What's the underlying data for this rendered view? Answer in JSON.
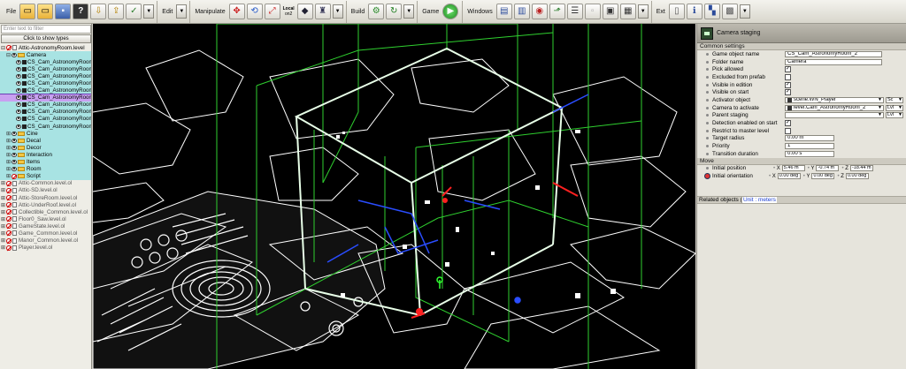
{
  "toolbar": {
    "groups": [
      {
        "label": "File"
      },
      {
        "label": "Edit"
      },
      {
        "label": "Manipulate"
      },
      {
        "label": "Build"
      },
      {
        "label": "Game"
      },
      {
        "label": "Windows"
      },
      {
        "label": "Ext"
      }
    ],
    "local_label": "Local",
    "local_sub": "on2"
  },
  "tree": {
    "filter_placeholder": "Enter text to filter",
    "types_button": "Click to show types",
    "root": "Attic-AstronomyRoom.level",
    "camera_folder": "Camera",
    "cameras": [
      "CS_Cam_AstronomyRoom",
      "CS_Cam_AstronomyRoom",
      "CS_Cam_AstronomyRoom",
      "CS_Cam_AstronomyRoom",
      "CS_Cam_AstronomyRoom",
      "CS_Cam_AstronomyRoom",
      "CS_Cam_AstronomyRoom",
      "CS_Cam_AstronomyRoom",
      "CS_Cam_AstronomyRoom",
      "CS_Cam_AstronomyRoom"
    ],
    "folders": [
      "Cine",
      "Decal",
      "Decor",
      "Interaction",
      "Items",
      "Room",
      "Script"
    ],
    "levels": [
      "Attic-Common.level.ol",
      "Attic-SD.level.ol",
      "Attic-StoreRoom.level.ol",
      "Attic-UnderRoof.level.ol",
      "Collectible_Common.level.ol",
      "Floor0_Saw.level.ol",
      "GameState.level.ol",
      "Game_Common.level.ol",
      "Manor_Common.level.ol",
      "Player.level.ol"
    ]
  },
  "props": {
    "title": "Camera staging",
    "section_common": "Common settings",
    "rows": [
      {
        "label": "Game object name",
        "kind": "text",
        "value": "CS_Cam_AstronomyRoom_2"
      },
      {
        "label": "Folder name",
        "kind": "text",
        "value": "Camera"
      },
      {
        "label": "Pick allowed",
        "kind": "check",
        "value": "✓"
      },
      {
        "label": "Excluded from prefab",
        "kind": "check",
        "value": ""
      },
      {
        "label": "Visible in edition",
        "kind": "check",
        "value": "✓"
      },
      {
        "label": "Visible on start",
        "kind": "check",
        "value": "✓"
      },
      {
        "label": "Activator object",
        "kind": "combo",
        "value": "scene.WN_Player",
        "extra": "Sc"
      },
      {
        "label": "Camera to activate",
        "kind": "combo",
        "value": "level.Cam_AstronomyRoom_2",
        "extra": "Lvl"
      },
      {
        "label": "Parent staging",
        "kind": "combo",
        "value": "",
        "extra": "Lvl"
      },
      {
        "label": "Detection enabled on start",
        "kind": "check",
        "value": "✓"
      },
      {
        "label": "Restrict to master level",
        "kind": "check",
        "value": ""
      },
      {
        "label": "Target radius",
        "kind": "text",
        "value": "0.00 m"
      },
      {
        "label": "Priority",
        "kind": "text",
        "value": "1"
      },
      {
        "label": "Transition duration",
        "kind": "text",
        "value": "0.00 s"
      }
    ],
    "section_move": "Move",
    "position_label": "Initial position",
    "position": {
      "x": "5.46 m",
      "y": "-0.74 m",
      "z": "-18.44 m"
    },
    "orientation_label": "Initial orientation",
    "orientation": {
      "x": "0.00 deg",
      "y": "0.00 deg",
      "z": "0.00 deg"
    },
    "axis_x": "X",
    "axis_y": "Y",
    "axis_z": "Z",
    "related": "Related objects (1)",
    "unit_tip": "Unit : meters"
  }
}
